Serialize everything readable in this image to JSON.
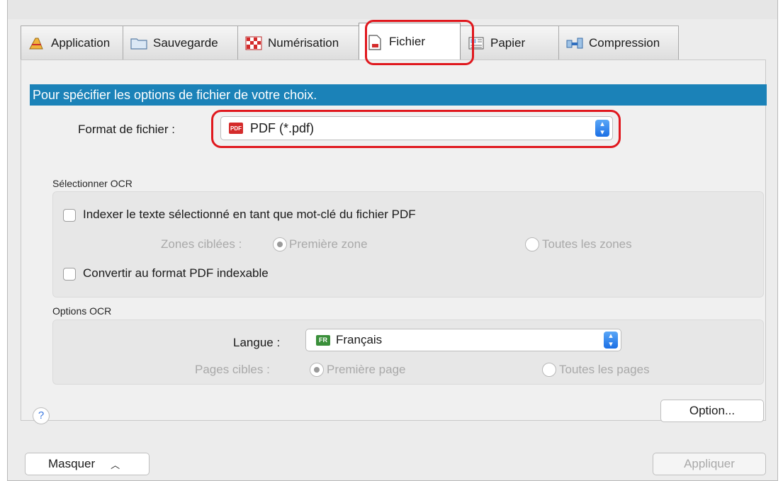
{
  "tabs": [
    {
      "label": "Application",
      "icon": "application-icon"
    },
    {
      "label": "Sauvegarde",
      "icon": "folder-icon"
    },
    {
      "label": "Numérisation",
      "icon": "scan-icon"
    },
    {
      "label": "Fichier",
      "icon": "file-icon",
      "active": true
    },
    {
      "label": "Papier",
      "icon": "paper-icon"
    },
    {
      "label": "Compression",
      "icon": "compression-icon"
    }
  ],
  "banner": "Pour spécifier les options de fichier de votre choix.",
  "file_format": {
    "label": "Format de fichier :",
    "icon_text": "PDF",
    "value": "PDF (*.pdf)"
  },
  "ocr_select": {
    "title": "Sélectionner OCR",
    "index_checkbox": "Indexer le texte sélectionné en tant que mot-clé du fichier PDF",
    "zones_label": "Zones ciblées :",
    "zone_first": "Première zone",
    "zone_all": "Toutes les zones",
    "convert_checkbox": "Convertir au format PDF indexable"
  },
  "ocr_options": {
    "title": "Options OCR",
    "language_label": "Langue :",
    "language_badge": "FR",
    "language_value": "Français",
    "pages_label": "Pages cibles :",
    "page_first": "Première page",
    "page_all": "Toutes les pages"
  },
  "buttons": {
    "help": "?",
    "option": "Option...",
    "hide": "Masquer",
    "apply": "Appliquer"
  },
  "colors": {
    "banner": "#1b82b8",
    "highlight": "#e0181e",
    "accent": "#1b6fe5"
  }
}
